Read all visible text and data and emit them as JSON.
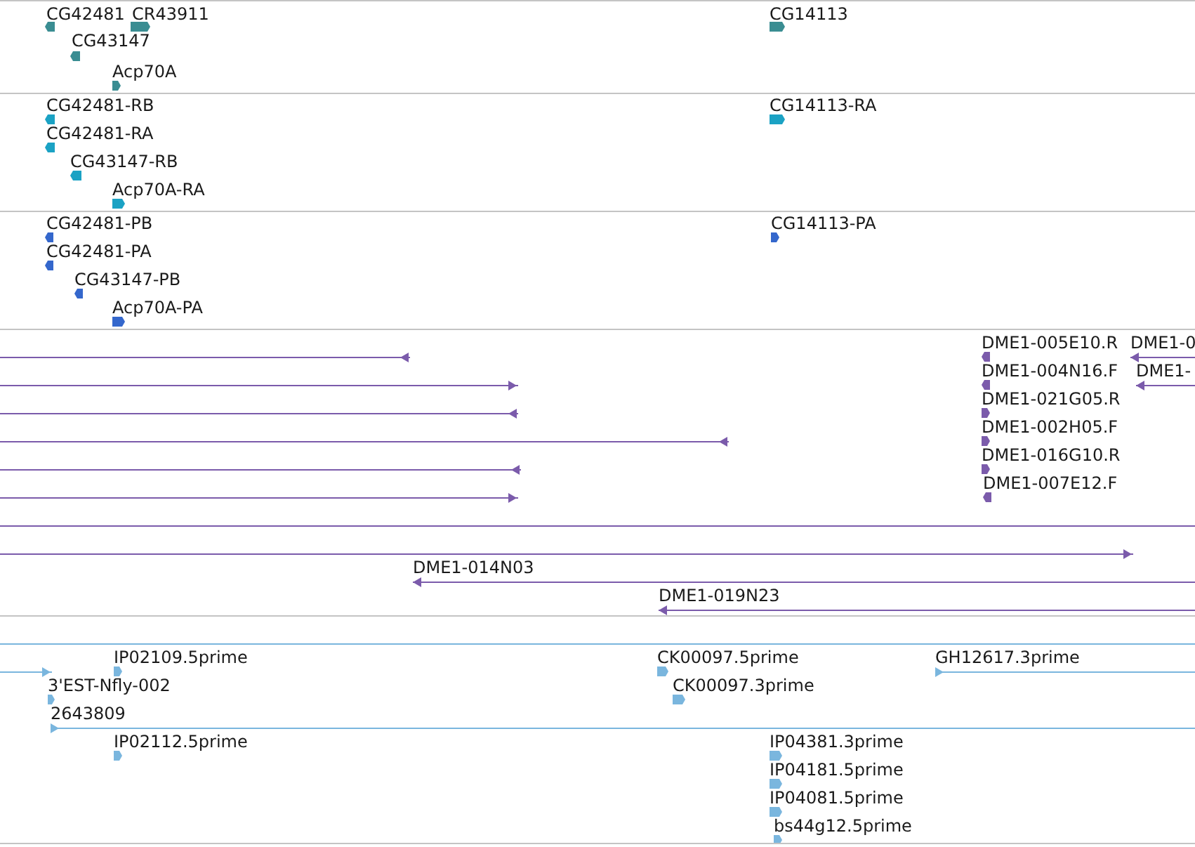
{
  "tracks": [
    {
      "color": "#3a8d92",
      "features": [
        {
          "kind": "arrow",
          "label": "CG42481",
          "reverse": true
        },
        {
          "kind": "arrow",
          "label": "CR43911",
          "reverse": false
        },
        {
          "kind": "arrow",
          "label": "CG43147",
          "reverse": true
        },
        {
          "kind": "arrow",
          "label": "Acp70A",
          "reverse": false
        },
        {
          "kind": "arrow",
          "label": "CG14113",
          "reverse": false
        }
      ]
    },
    {
      "color": "#1ba2c4",
      "features": [
        {
          "kind": "arrow",
          "label": "CG42481-RB",
          "reverse": true
        },
        {
          "kind": "arrow",
          "label": "CG42481-RA",
          "reverse": true
        },
        {
          "kind": "arrow",
          "label": "CG43147-RB",
          "reverse": true
        },
        {
          "kind": "arrow",
          "label": "Acp70A-RA",
          "reverse": false
        },
        {
          "kind": "arrow",
          "label": "CG14113-RA",
          "reverse": false
        }
      ]
    },
    {
      "color": "#3467cc",
      "features": [
        {
          "kind": "arrow",
          "label": "CG42481-PB",
          "reverse": true
        },
        {
          "kind": "arrow",
          "label": "CG42481-PA",
          "reverse": true
        },
        {
          "kind": "arrow",
          "label": "CG43147-PB",
          "reverse": true
        },
        {
          "kind": "arrow",
          "label": "Acp70A-PA",
          "reverse": false
        },
        {
          "kind": "arrow",
          "label": "CG14113-PA",
          "reverse": false
        }
      ]
    },
    {
      "color": "#7b5bab",
      "features": [
        {
          "kind": "line",
          "reverse": true
        },
        {
          "kind": "arrow",
          "label": "DME1-005E10.R",
          "reverse": true
        },
        {
          "kind": "line",
          "label": "DME1-0",
          "reverse": true
        },
        {
          "kind": "line",
          "reverse": false
        },
        {
          "kind": "arrow",
          "label": "DME1-004N16.F",
          "reverse": true
        },
        {
          "kind": "line",
          "label": "DME1-",
          "reverse": true
        },
        {
          "kind": "line",
          "reverse": true
        },
        {
          "kind": "arrow",
          "label": "DME1-021G05.R",
          "reverse": false
        },
        {
          "kind": "line",
          "reverse": true
        },
        {
          "kind": "arrow",
          "label": "DME1-002H05.F",
          "reverse": false
        },
        {
          "kind": "line",
          "reverse": true
        },
        {
          "kind": "arrow",
          "label": "DME1-016G10.R",
          "reverse": false
        },
        {
          "kind": "line",
          "reverse": false
        },
        {
          "kind": "arrow",
          "label": "DME1-007E12.F",
          "reverse": true
        },
        {
          "kind": "span"
        },
        {
          "kind": "line",
          "reverse": false
        },
        {
          "kind": "line",
          "label": "DME1-014N03",
          "reverse": true
        },
        {
          "kind": "line",
          "label": "DME1-019N23",
          "reverse": true
        }
      ]
    },
    {
      "color": "#7ab6de",
      "features": [
        {
          "kind": "span"
        },
        {
          "kind": "arrow",
          "label": "IP02109.5prime",
          "reverse": false
        },
        {
          "kind": "line",
          "reverse": false
        },
        {
          "kind": "arrow",
          "label": "CK00097.5prime",
          "reverse": false
        },
        {
          "kind": "line",
          "label": "GH12617.3prime",
          "reverse": false
        },
        {
          "kind": "arrow",
          "label": "3'EST-Nfly-002",
          "reverse": false
        },
        {
          "kind": "arrow",
          "label": "CK00097.3prime",
          "reverse": false
        },
        {
          "kind": "line",
          "label": "2643809",
          "reverse": false
        },
        {
          "kind": "arrow",
          "label": "IP02112.5prime",
          "reverse": false
        },
        {
          "kind": "arrow",
          "label": "IP04381.3prime",
          "reverse": false
        },
        {
          "kind": "arrow",
          "label": "IP04181.5prime",
          "reverse": false
        },
        {
          "kind": "arrow",
          "label": "IP04081.5prime",
          "reverse": false
        },
        {
          "kind": "arrow",
          "label": "bs44g12.5prime",
          "reverse": false
        }
      ]
    }
  ]
}
